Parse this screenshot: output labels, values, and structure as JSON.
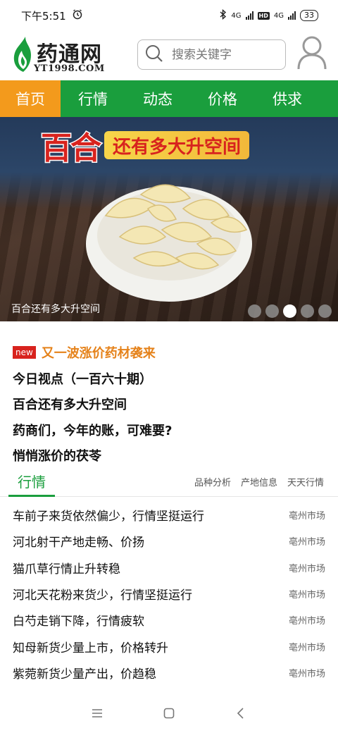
{
  "status": {
    "time": "下午5:51",
    "network1": "4G",
    "hd": "HD",
    "network2": "4G",
    "battery": "33"
  },
  "header": {
    "logo_title": "药通网",
    "logo_sub": "YT1998.COM",
    "search_placeholder": "搜索关键字"
  },
  "nav": {
    "items": [
      {
        "label": "首页"
      },
      {
        "label": "行情"
      },
      {
        "label": "动态"
      },
      {
        "label": "价格"
      },
      {
        "label": "供求"
      }
    ]
  },
  "banner": {
    "title_big": "百合",
    "title_rest": "还有多大升空间",
    "caption": "百合还有多大升空间",
    "slide_count": 5,
    "active_slide": 3
  },
  "headlines": {
    "badge": "new",
    "items": [
      {
        "text": "又一波涨价药材袭来"
      },
      {
        "text": "今日视点（一百六十期）"
      },
      {
        "text": "百合还有多大升空间"
      },
      {
        "text": "药商们，今年的账，可难要?"
      },
      {
        "text": "悄悄涨价的茯苓"
      }
    ]
  },
  "market": {
    "title": "行情",
    "sub_tabs": [
      "品种分析",
      "产地信息",
      "天天行情"
    ],
    "rows": [
      {
        "title": "车前子来货依然偏少，行情坚挺运行",
        "market": "亳州市场"
      },
      {
        "title": "河北射干产地走畅、价扬",
        "market": "亳州市场"
      },
      {
        "title": "猫爪草行情止升转稳",
        "market": "亳州市场"
      },
      {
        "title": "河北天花粉来货少，行情坚挺运行",
        "market": "亳州市场"
      },
      {
        "title": "白芍走销下降，行情疲软",
        "market": "亳州市场"
      },
      {
        "title": "知母新货少量上市，价格转升",
        "market": "亳州市场"
      },
      {
        "title": "紫菀新货少量产出，价趋稳",
        "market": "亳州市场"
      }
    ]
  },
  "colors": {
    "brand_green": "#1a9e3d",
    "active_orange": "#f39a1c",
    "hot_orange": "#e5821a",
    "new_red": "#d8231e"
  }
}
